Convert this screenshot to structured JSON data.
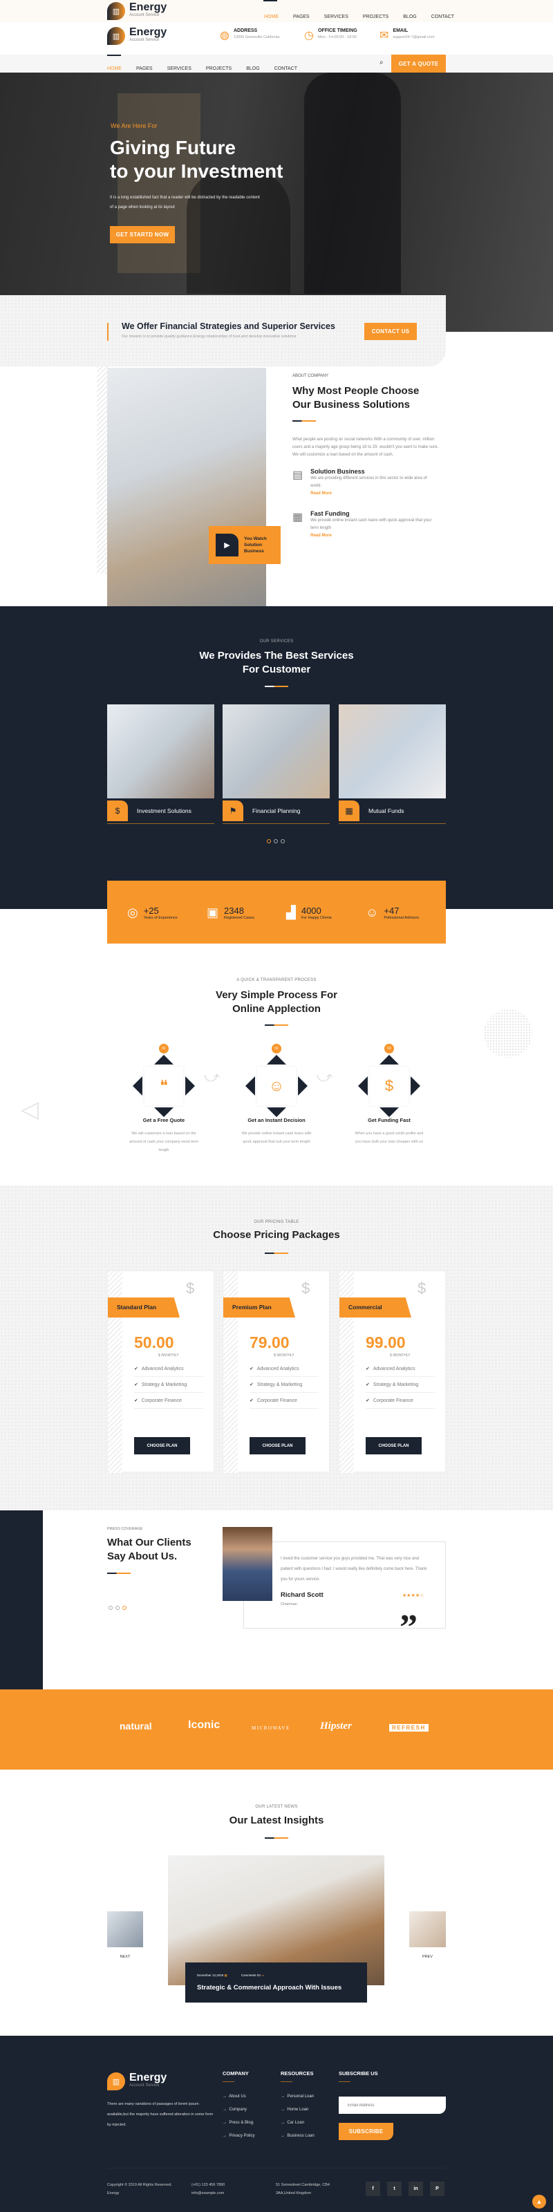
{
  "brand": {
    "name": "Energy",
    "tagline": "Account Service"
  },
  "nav": {
    "items": [
      "HOME",
      "PAGES",
      "SERVICES",
      "PROJECTS",
      "BLOG",
      "CONTACT"
    ],
    "active": "HOME",
    "quote_button": "GET A QUOTE"
  },
  "contact_info": [
    {
      "icon": "globe-icon",
      "label": "ADDRESS",
      "value": "13005 Greenville California."
    },
    {
      "icon": "clock-icon",
      "label": "OFFICE TIMEING",
      "value": "Mon - Fri:09:00 - 18:00"
    },
    {
      "icon": "envelope-icon",
      "label": "EMAIL",
      "value": "support24-7@gmail.com"
    }
  ],
  "hero": {
    "kicker": "We Are Here For",
    "title_line1": "Giving Future",
    "title_line2": "to your Investment",
    "text": "It is a long established fact that a reader will be distracted by the readable content of a page when looking at its layout",
    "button": "GET STARTD NOW"
  },
  "offer": {
    "title": "We Offer Financial Strategies and Superior Services",
    "text": "Our mission is to provide quality guidance,Energy relationships of trust,and develop innovative solutions",
    "button": "CONTACT US"
  },
  "about": {
    "tag": "ABOUT COMPANY",
    "title_line1": "Why Most People Choose",
    "title_line2": "Our Business Solutions",
    "text": "What people are posting on social networks With a community of over. million users and a majority age group being 18 to 29. wouldn't you want to make sure. We will customize a loan based on the amount of cash.",
    "video_label": "You Watch Solution Business",
    "features": [
      {
        "title": "Solution Business",
        "text": "We are providing different services in this sector to wide area of world.",
        "link": "Read More"
      },
      {
        "title": "Fast Funding",
        "text": "We provide online instant cash loans with quick approval that your term length",
        "link": "Read More"
      }
    ]
  },
  "services": {
    "tag": "OUR SERVICES",
    "title_line1": "We Provides The Best Services",
    "title_line2": "For Customer",
    "items": [
      {
        "label": "Investment Solutions"
      },
      {
        "label": "Financial Planning"
      },
      {
        "label": "Mutual Funds"
      }
    ],
    "active_dot": 1,
    "dots": 3
  },
  "stats": [
    {
      "value": "+25",
      "label": "Years of Experience"
    },
    {
      "value": "2348",
      "label": "Registered Cases"
    },
    {
      "value": "4000",
      "label": "For Happy Clients"
    },
    {
      "value": "+47",
      "label": "Pofessional Advisors"
    }
  ],
  "process": {
    "tag": "A QUICK & TRANSPARENT PROCESS",
    "title_line1": "Very Simple Process For",
    "title_line2": "Online Applection",
    "steps": [
      {
        "num": "01",
        "title": "Get a Free Quote",
        "text": "We will customize a loan based on the amount of cash your company need term length"
      },
      {
        "num": "02",
        "title": "Get an Instant Decision",
        "text": "We provide online instant cash loans with quick approval that suit your term length"
      },
      {
        "num": "03",
        "title": "Get Funding Fast",
        "text": "When you have a good credit profile and you have built your loan cheaper with us"
      }
    ]
  },
  "pricing": {
    "tag": "OUR PRICING TABLE",
    "title": "Choose Pricing Packages",
    "plans": [
      {
        "name": "Standard Plan",
        "price": "50.00",
        "period": "$ /MONTHLY",
        "features": [
          "Advanced Analytics",
          "Strategy & Marketing",
          "Corporate Finance"
        ],
        "button": "CHOOSE PLAN"
      },
      {
        "name": "Premium Plan",
        "price": "79.00",
        "period": "$ /MONTHLY",
        "features": [
          "Advanced Analytics",
          "Strategy & Marketing",
          "Corporate Finance"
        ],
        "button": "CHOOSE PLAN"
      },
      {
        "name": "Commercial",
        "price": "99.00",
        "period": "$ /MONTHLY",
        "features": [
          "Advanced Analytics",
          "Strategy & Marketing",
          "Corporate Finance"
        ],
        "button": "CHOOSE PLAN"
      }
    ]
  },
  "testimonial": {
    "tag": "PRESS COVERAGE",
    "title_line1": "What Our Clients",
    "title_line2": "Say About Us.",
    "quote": "I loved the customer service you guys provided me. That was very nice and patient with questions I had. I would really like definitely come back here. Thank you for yours service.",
    "name": "Richard Scott",
    "role": "Chairman",
    "rating": 4,
    "rating_max": 5,
    "active_dot": 3
  },
  "partners": [
    "natural",
    "Iconic",
    "MICROWAVE",
    "Hipster",
    "REFRESH"
  ],
  "news": {
    "tag": "OUR LATEST NEWS",
    "title": "Our Latest Insights",
    "date": "December 12,2018",
    "comments": "Comments 03",
    "post_title": "Strategic & Commercial Approach With Issues",
    "next": "NEXT",
    "prev": "PREV"
  },
  "footer": {
    "about": "There are many variations of passages of lorem ipsum available,but the majority have suffered alteration in some form by injected.",
    "company": {
      "title": "COMPANY",
      "links": [
        "About Us",
        "Company",
        "Press & Blog.",
        "Privacy Policy"
      ]
    },
    "resources": {
      "title": "RESOURCES",
      "links": [
        "Personal Loan",
        "Home Loan",
        "Car Loan",
        "Business Loan"
      ]
    },
    "subscribe": {
      "title": "SUBSCRIBE US",
      "placeholder": "Email Address",
      "button": "SUBSCRIBE"
    },
    "copyright": "Copyright © 2019 All Rights Reserved. Energy",
    "phone": "(+01) 123 456 7890",
    "email": "info@example.com",
    "address": "51 Somestreet Cambridge, CB4 3AA,United Kingdom",
    "social": [
      "facebook-icon",
      "twitter-icon",
      "linkedin-icon",
      "pinterest-icon"
    ]
  },
  "colors": {
    "accent": "#f7962b",
    "navy": "#1b2331"
  }
}
